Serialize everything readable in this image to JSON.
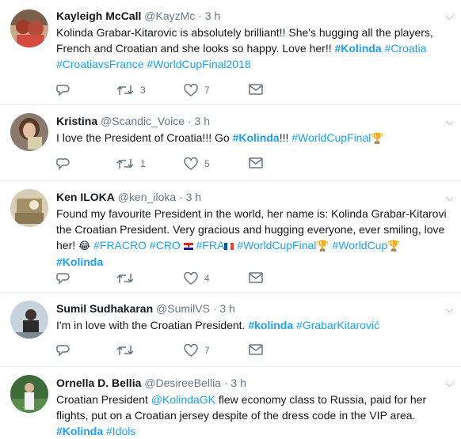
{
  "tweets": [
    {
      "name": "Kayleigh McCall",
      "handle": "@KayzMc",
      "dot": "·",
      "time": "3 h",
      "text_parts": [
        "Kolinda Grabar-Kitarovic is absolutely brilliant!! She's hugging all the players, French and Croatian and she looks so happy. Love her!! "
      ],
      "tags": [
        "#Kolinda",
        "#Croatia",
        "#CroatiavsFrance",
        "#WorldCupFinal2018"
      ],
      "retweets": "3",
      "likes": "7"
    },
    {
      "name": "Kristina",
      "handle": "@Scandic_Voice",
      "dot": "·",
      "time": "3 h",
      "text_parts": [
        "I love the President of Croatia!!! Go ",
        "!!!  "
      ],
      "tags": [
        "#Kolinda",
        "#WorldCupFinal"
      ],
      "retweets": "1",
      "likes": "5"
    },
    {
      "name": "Ken ILOKA",
      "handle": "@ken_iloka",
      "dot": "·",
      "time": "3 h",
      "text_parts": [
        "Found my favourite President in the world, her name is:  Kolinda Grabar-Kitarovi the Croatian President. Very gracious and hugging everyone, ever smiling, love her! "
      ],
      "tags": [
        "#FRACRO",
        "#CRO",
        "#FRA",
        "#WorldCupFinal",
        "#WorldCup",
        "#Kolinda"
      ],
      "retweets": "",
      "likes": "4"
    },
    {
      "name": "Sumil Sudhakaran",
      "handle": "@SumilVS",
      "dot": "·",
      "time": "3 h",
      "text_parts": [
        "I'm in love with the Croatian President. "
      ],
      "tags": [
        "#kolinda",
        "#GrabarKitarović"
      ],
      "retweets": "",
      "likes": "7"
    },
    {
      "name": "Ornella D. Bellia",
      "handle": "@DesireeBellia",
      "dot": "·",
      "time": "3 h",
      "text_parts": [
        "Croatian President ",
        " flew economy class to Russia, paid for her flights, put on a Croatian jersey despite of the dress code in the VIP area.  "
      ],
      "mention": "@KolindaGK",
      "tags": [
        "#Kolinda",
        "#Idols"
      ]
    }
  ],
  "icons": {
    "reply": "reply-icon",
    "retweet": "retweet-icon",
    "like": "heart-icon",
    "message": "envelope-icon",
    "menu": "chevron-down-icon"
  },
  "colors": {
    "link": "#1da1f2",
    "secondary": "#657786",
    "border": "#e6ecf0"
  }
}
